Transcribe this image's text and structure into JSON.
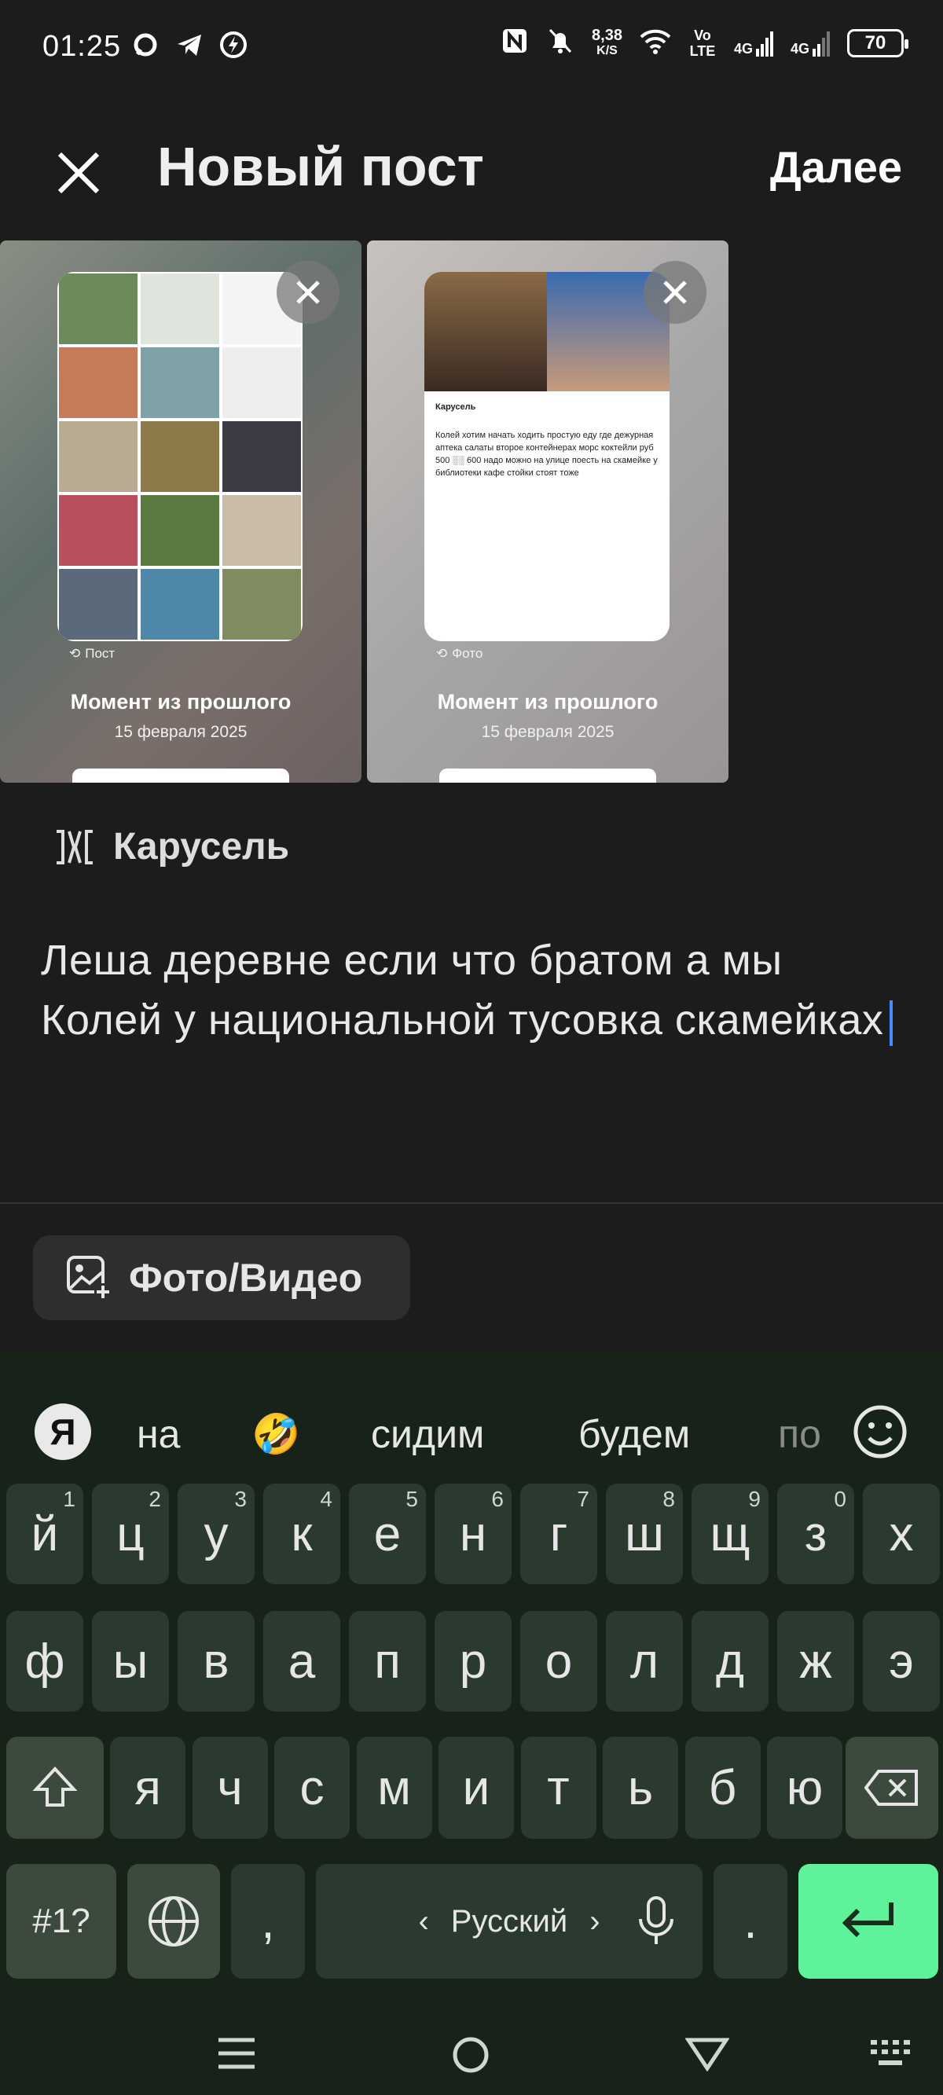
{
  "status_bar": {
    "time": "01:25",
    "speed_value": "8,38",
    "speed_unit": "K/S",
    "volte": "Vo LTE",
    "net1": "4G",
    "net2": "4G",
    "battery": "70"
  },
  "header": {
    "title": "Новый пост",
    "next_label": "Далее"
  },
  "cards": [
    {
      "kind": "Пост",
      "title": "Момент из прошлого",
      "date": "15 февраля 2025"
    },
    {
      "kind": "Фото",
      "title": "Момент из прошлого",
      "date": "15 февраля 2025",
      "inner_heading": "Карусель",
      "inner_text": "Колей хотим начать ходить простую еду где дежурная аптека салаты второе контейнерах морс коктейли руб 500 ░░ 600 надо можно на улице поесть на скамейке у библиотеки кафе стойки стоят тоже"
    }
  ],
  "carousel_label": "Карусель",
  "post_text": "Леша деревне если что братом а мы Колей у национальной тусовка скамейках",
  "media_button": "Фото/Видео",
  "keyboard": {
    "ya": "Я",
    "suggestions": [
      "на",
      "🤣",
      "сидим",
      "будем",
      "по"
    ],
    "row1": [
      "й",
      "ц",
      "у",
      "к",
      "е",
      "н",
      "г",
      "ш",
      "щ",
      "з",
      "х"
    ],
    "row1_hints": [
      "1",
      "2",
      "3",
      "4",
      "5",
      "6",
      "7",
      "8",
      "9",
      "0",
      ""
    ],
    "row2": [
      "ф",
      "ы",
      "в",
      "а",
      "п",
      "р",
      "о",
      "л",
      "д",
      "ж",
      "э"
    ],
    "row3": [
      "я",
      "ч",
      "с",
      "м",
      "и",
      "т",
      "ь",
      "б",
      "ю"
    ],
    "symbols_label": "#1?",
    "comma": ",",
    "period": ".",
    "space_label": "Русский"
  },
  "colors": {
    "background": "#1c1c1c",
    "keyboard_bg": "#172318",
    "key_bg": "#2b3a2e",
    "enter_key": "#5ef29a",
    "cursor": "#4a88ff"
  }
}
